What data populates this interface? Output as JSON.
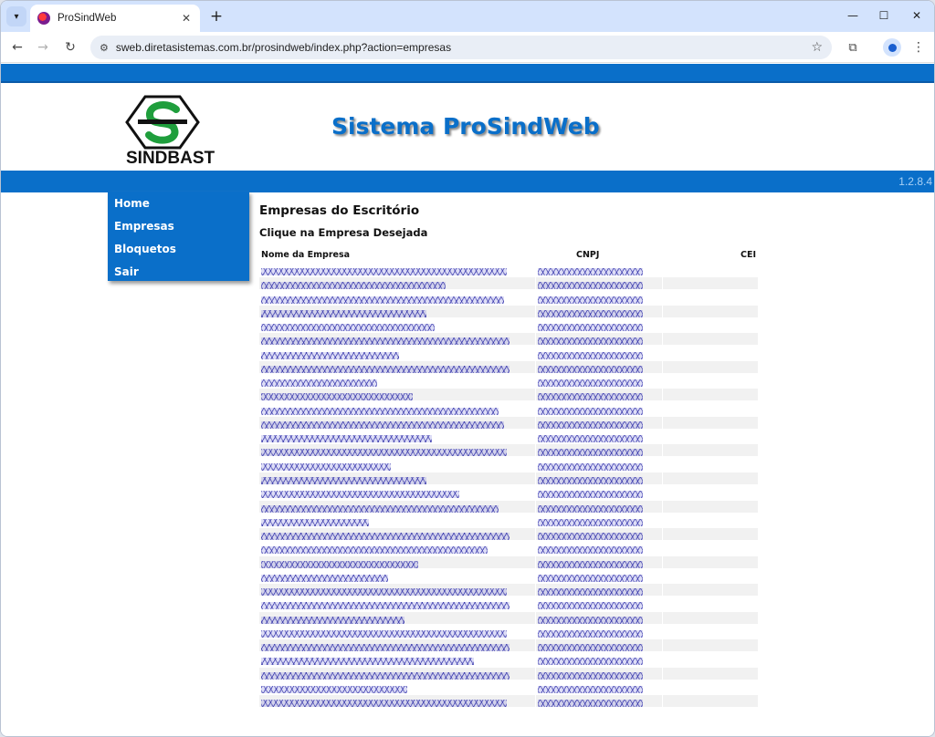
{
  "browser": {
    "tab_title": "ProSindWeb",
    "url": "sweb.diretasistemas.com.br/prosindweb/index.php?action=empresas"
  },
  "icons": {
    "tab_menu": "▾",
    "tab_close": "✕",
    "new_tab": "+",
    "minimize": "—",
    "maximize": "☐",
    "close": "✕",
    "back": "←",
    "forward": "→",
    "reload": "↻",
    "site_info": "⚙",
    "star": "☆",
    "extensions": "⧉",
    "kebab": "⋮"
  },
  "header": {
    "logo_text": "SINDBAST",
    "title": "Sistema ProSindWeb",
    "version": "1.2.8.4"
  },
  "menu": [
    {
      "label": "Home"
    },
    {
      "label": "Empresas"
    },
    {
      "label": "Bloquetos"
    },
    {
      "label": "Sair"
    }
  ],
  "content": {
    "title": "Empresas do Escritório",
    "subtitle": "Clique na Empresa Desejada",
    "columns": {
      "name": "Nome da Empresa",
      "cnpj": "CNPJ",
      "cei": "CEI"
    }
  },
  "colors": {
    "brand_blue": "#0a6fc9",
    "logo_green": "#1f9e3c",
    "redaction": "#2a2ab0"
  },
  "rows": [
    {
      "name_redacted": 0.89,
      "cnpj_redacted": 0.83
    },
    {
      "name_redacted": 0.67,
      "cnpj_redacted": 0.83
    },
    {
      "name_redacted": 0.88,
      "cnpj_redacted": 0.83
    },
    {
      "name_redacted": 0.6,
      "cnpj_redacted": 0.83
    },
    {
      "name_redacted": 0.63,
      "cnpj_redacted": 0.83
    },
    {
      "name_redacted": 0.9,
      "cnpj_redacted": 0.83
    },
    {
      "name_redacted": 0.5,
      "cnpj_redacted": 0.83
    },
    {
      "name_redacted": 0.9,
      "cnpj_redacted": 0.83
    },
    {
      "name_redacted": 0.42,
      "cnpj_redacted": 0.83
    },
    {
      "name_redacted": 0.55,
      "cnpj_redacted": 0.83
    },
    {
      "name_redacted": 0.86,
      "cnpj_redacted": 0.83
    },
    {
      "name_redacted": 0.88,
      "cnpj_redacted": 0.83
    },
    {
      "name_redacted": 0.62,
      "cnpj_redacted": 0.83
    },
    {
      "name_redacted": 0.89,
      "cnpj_redacted": 0.83
    },
    {
      "name_redacted": 0.47,
      "cnpj_redacted": 0.83
    },
    {
      "name_redacted": 0.6,
      "cnpj_redacted": 0.83
    },
    {
      "name_redacted": 0.72,
      "cnpj_redacted": 0.83
    },
    {
      "name_redacted": 0.86,
      "cnpj_redacted": 0.83
    },
    {
      "name_redacted": 0.39,
      "cnpj_redacted": 0.83
    },
    {
      "name_redacted": 0.9,
      "cnpj_redacted": 0.83
    },
    {
      "name_redacted": 0.82,
      "cnpj_redacted": 0.83
    },
    {
      "name_redacted": 0.57,
      "cnpj_redacted": 0.83
    },
    {
      "name_redacted": 0.46,
      "cnpj_redacted": 0.83
    },
    {
      "name_redacted": 0.89,
      "cnpj_redacted": 0.83
    },
    {
      "name_redacted": 0.9,
      "cnpj_redacted": 0.83
    },
    {
      "name_redacted": 0.52,
      "cnpj_redacted": 0.83
    },
    {
      "name_redacted": 0.89,
      "cnpj_redacted": 0.83
    },
    {
      "name_redacted": 0.9,
      "cnpj_redacted": 0.83
    },
    {
      "name_redacted": 0.77,
      "cnpj_redacted": 0.83
    },
    {
      "name_redacted": 0.9,
      "cnpj_redacted": 0.83
    },
    {
      "name_redacted": 0.53,
      "cnpj_redacted": 0.83
    },
    {
      "name_redacted": 0.89,
      "cnpj_redacted": 0.83
    }
  ]
}
